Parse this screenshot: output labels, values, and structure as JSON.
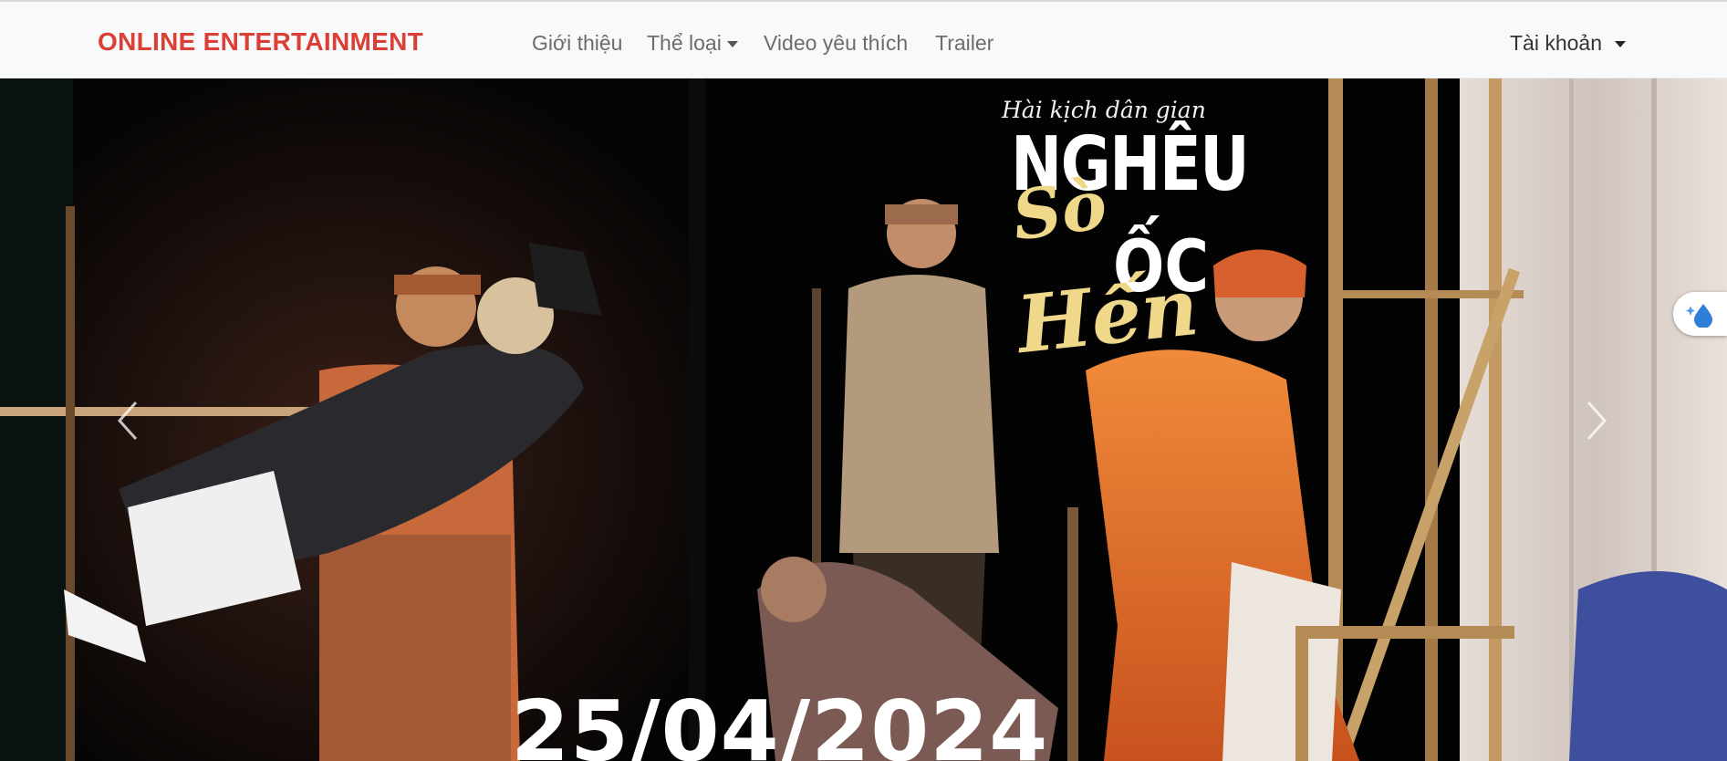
{
  "navbar": {
    "brand": "ONLINE ENTERTAINMENT",
    "links": [
      {
        "label": "Giới thiệu"
      },
      {
        "label": "Thể loại"
      },
      {
        "label": "Video yêu thích"
      },
      {
        "label": "Trailer"
      }
    ],
    "account_label": "Tài khoản"
  },
  "carousel": {
    "poster": {
      "subtitle": "Hài kịch dân gian",
      "title": "NGHÊU",
      "word_so": "Sò",
      "word_oc": "ỐC",
      "word_hen": "Hến"
    },
    "date": "25/04/2024"
  },
  "icons": {
    "prev": "chevron-left-icon",
    "next": "chevron-right-icon",
    "dropdown": "caret-down-icon",
    "widget": "water-drop-sparkle-icon"
  },
  "colors": {
    "brand": "#dc3f35",
    "navbar_bg": "#f8f9fa",
    "nav_text": "#6c6c6c",
    "costume_orange": "#e2662a"
  }
}
